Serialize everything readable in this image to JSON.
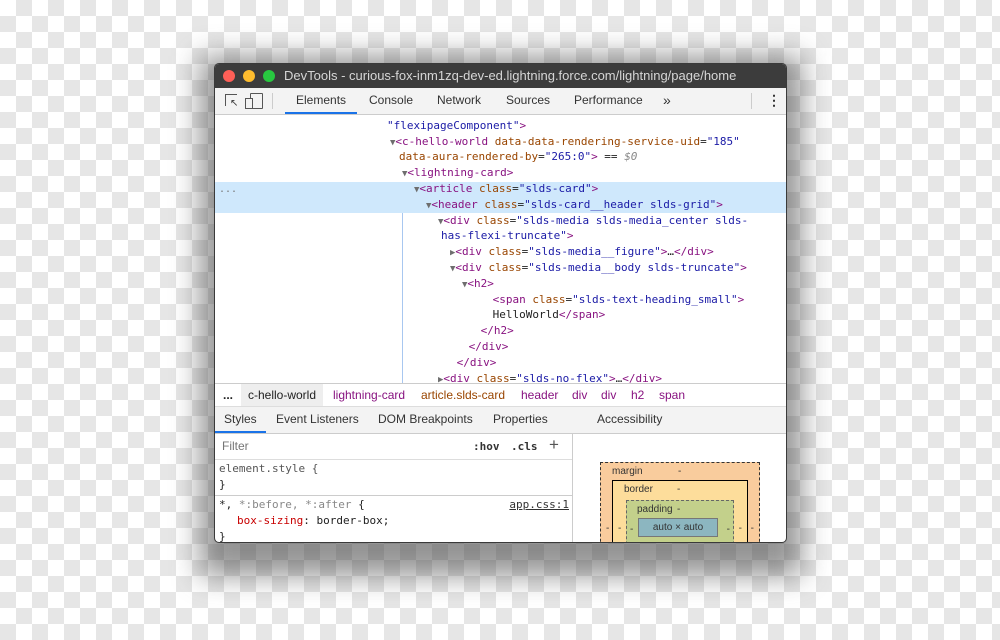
{
  "window": {
    "title": "DevTools - curious-fox-inm1zq-dev-ed.lightning.force.com/lightning/page/home",
    "traffic_lights": {
      "close": "#fe5f57",
      "minimize": "#febc2e",
      "zoom": "#28c840"
    }
  },
  "toolbar": {
    "tabs": [
      "Elements",
      "Console",
      "Network",
      "Sources",
      "Performance"
    ],
    "active": "Elements",
    "more": "»",
    "menu": "⋮",
    "icons": [
      "inspect-element-icon",
      "device-toolbar-icon"
    ]
  },
  "dom": {
    "ellipsis": "...",
    "lines": [
      {
        "depth": 0,
        "toggle": "",
        "tokens": [
          [
            "val",
            "\"flexipageComponent\""
          ],
          [
            "pun",
            ">"
          ]
        ]
      },
      {
        "depth": 1,
        "toggle": "▼",
        "tokens": [
          [
            "pun",
            "<"
          ],
          [
            "tag",
            "c-hello-world"
          ],
          [
            "attr",
            " data-data-rendering-service-uid"
          ],
          [
            "eq",
            "="
          ],
          [
            "val",
            "\"185\""
          ]
        ]
      },
      {
        "depth": 0,
        "toggle": "",
        "tokens": [
          [
            "attr",
            "data-aura-rendered-by"
          ],
          [
            "eq",
            "="
          ],
          [
            "val",
            "\"265:0\""
          ],
          [
            "pun",
            ">"
          ],
          [
            "eq",
            " == "
          ],
          [
            "dim",
            "$0"
          ]
        ]
      },
      {
        "depth": 2,
        "toggle": "▼",
        "tokens": [
          [
            "pun",
            "<"
          ],
          [
            "tag",
            "lightning-card"
          ],
          [
            "pun",
            ">"
          ]
        ]
      },
      {
        "depth": 3,
        "toggle": "▼",
        "tokens": [
          [
            "pun",
            "<"
          ],
          [
            "tag",
            "article"
          ],
          [
            "attr",
            " class"
          ],
          [
            "eq",
            "="
          ],
          [
            "val",
            "\"slds-card\""
          ],
          [
            "pun",
            ">"
          ]
        ]
      },
      {
        "depth": 4,
        "toggle": "▼",
        "tokens": [
          [
            "pun",
            "<"
          ],
          [
            "tag",
            "header"
          ],
          [
            "attr",
            " class"
          ],
          [
            "eq",
            "="
          ],
          [
            "val",
            "\"slds-card__header slds-grid\""
          ],
          [
            "pun",
            ">"
          ]
        ]
      },
      {
        "depth": 5,
        "toggle": "▼",
        "tokens": [
          [
            "pun",
            "<"
          ],
          [
            "tag",
            "div"
          ],
          [
            "attr",
            " class"
          ],
          [
            "eq",
            "="
          ],
          [
            "val",
            "\"slds-media slds-media_center slds-"
          ]
        ]
      },
      {
        "depth": 4.5,
        "toggle": "",
        "tokens": [
          [
            "val",
            "has-flexi-truncate\""
          ],
          [
            "pun",
            ">"
          ]
        ]
      },
      {
        "depth": 6,
        "toggle": "▶",
        "tokens": [
          [
            "pun",
            "<"
          ],
          [
            "tag",
            "div"
          ],
          [
            "attr",
            " class"
          ],
          [
            "eq",
            "="
          ],
          [
            "val",
            "\"slds-media__figure\""
          ],
          [
            "pun",
            ">"
          ],
          [
            "txt",
            "…"
          ],
          [
            "pun",
            "</"
          ],
          [
            "tag",
            "div"
          ],
          [
            "pun",
            ">"
          ]
        ]
      },
      {
        "depth": 6,
        "toggle": "▼",
        "tokens": [
          [
            "pun",
            "<"
          ],
          [
            "tag",
            "div"
          ],
          [
            "attr",
            " class"
          ],
          [
            "eq",
            "="
          ],
          [
            "val",
            "\"slds-media__body slds-truncate\""
          ],
          [
            "pun",
            ">"
          ]
        ]
      },
      {
        "depth": 7,
        "toggle": "▼",
        "tokens": [
          [
            "pun",
            "<"
          ],
          [
            "tag",
            "h2"
          ],
          [
            "pun",
            ">"
          ]
        ]
      },
      {
        "depth": 8.8,
        "toggle": "",
        "tokens": [
          [
            "pun",
            "<"
          ],
          [
            "tag",
            "span"
          ],
          [
            "attr",
            " class"
          ],
          [
            "eq",
            "="
          ],
          [
            "val",
            "\"slds-text-heading_small\""
          ],
          [
            "pun",
            ">"
          ]
        ]
      },
      {
        "depth": 8.8,
        "toggle": "",
        "tokens": [
          [
            "txt",
            "HelloWorld"
          ],
          [
            "pun",
            "</"
          ],
          [
            "tag",
            "span"
          ],
          [
            "pun",
            ">"
          ]
        ]
      },
      {
        "depth": 7.8,
        "toggle": "",
        "tokens": [
          [
            "pun",
            "</"
          ],
          [
            "tag",
            "h2"
          ],
          [
            "pun",
            ">"
          ]
        ]
      },
      {
        "depth": 6.8,
        "toggle": "",
        "tokens": [
          [
            "pun",
            "</"
          ],
          [
            "tag",
            "div"
          ],
          [
            "pun",
            ">"
          ]
        ]
      },
      {
        "depth": 5.8,
        "toggle": "",
        "tokens": [
          [
            "pun",
            "</"
          ],
          [
            "tag",
            "div"
          ],
          [
            "pun",
            ">"
          ]
        ]
      },
      {
        "depth": 5,
        "toggle": "▶",
        "tokens": [
          [
            "pun",
            "<"
          ],
          [
            "tag",
            "div"
          ],
          [
            "attr",
            " class"
          ],
          [
            "eq",
            "="
          ],
          [
            "val",
            "\"slds-no-flex\""
          ],
          [
            "pun",
            ">"
          ],
          [
            "txt",
            "…"
          ],
          [
            "pun",
            "</"
          ],
          [
            "tag",
            "div"
          ],
          [
            "pun",
            ">"
          ]
        ]
      }
    ]
  },
  "breadcrumb": {
    "ellipsis": "...",
    "items": [
      "c-hello-world",
      "lightning-card",
      "article.slds-card",
      "header",
      "div",
      "div",
      "h2",
      "span"
    ]
  },
  "subtabs": {
    "tabs": [
      "Styles",
      "Event Listeners",
      "DOM Breakpoints",
      "Properties",
      "Accessibility"
    ],
    "active": "Styles"
  },
  "styles": {
    "filter_placeholder": "Filter",
    "hov": ":hov",
    "cls": ".cls",
    "add": "+",
    "rule1": {
      "selector": "element.style {",
      "close": "}"
    },
    "rule2": {
      "selector_star": "*, ",
      "selector_rest": "*:before, *:after",
      "open": " {",
      "source": "app.css:1",
      "prop": "box-sizing",
      "value": "border-box;",
      "close": "}"
    }
  },
  "box_model": {
    "margin": "margin",
    "border": "border",
    "padding": "padding",
    "content": "auto × auto",
    "dash": "-",
    "colors": {
      "margin": "#f9cc9d",
      "border": "#fddd9b",
      "padding": "#c3d08b",
      "content": "#8cb6c0"
    }
  }
}
